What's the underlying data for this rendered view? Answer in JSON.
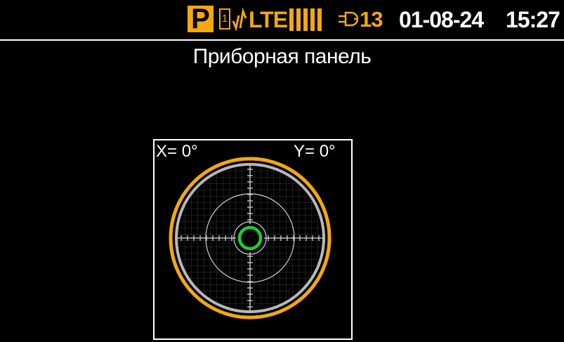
{
  "status_bar": {
    "mode_badge": "P",
    "sim_slot": "1",
    "network_type": "LTE",
    "signal_bars": 5,
    "connections_count": "13",
    "date": "01-08-24",
    "time": "15:27",
    "icons": [
      "antenna-icon",
      "signal-bars-icon",
      "plug-icon"
    ],
    "accent_color": "#f3a712"
  },
  "page": {
    "title": "Приборная панель"
  },
  "level_gauge": {
    "x_label": "X= 0°",
    "y_label": "Y= 0°",
    "x_value_deg": 0,
    "y_value_deg": 0,
    "outer_ring_color": "#f3a712",
    "inner_ring_color": "#b8b8b8",
    "bubble_color": "#22cc33"
  }
}
